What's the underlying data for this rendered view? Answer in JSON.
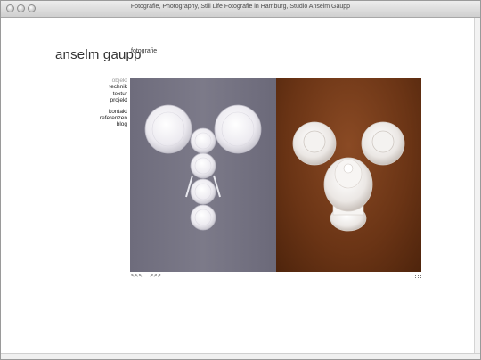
{
  "window": {
    "title": "Fotografie, Photography, Still Life Fotografie in Hamburg, Studio Anselm Gaupp"
  },
  "site": {
    "name": "anselm gaupp",
    "subtitle": "fotografie"
  },
  "nav": {
    "group1": [
      "objekt",
      "technik",
      "textur",
      "projekt"
    ],
    "group2": [
      "kontakt",
      "referenzen",
      "blog"
    ],
    "active": "objekt"
  },
  "pager": {
    "prev": "<<<",
    "next": ">>>"
  },
  "colors": {
    "left_backdrop": "#75737f",
    "right_backdrop": "#6a3415",
    "porcelain": "#ffffff"
  },
  "icons": [
    "grid-icon"
  ]
}
